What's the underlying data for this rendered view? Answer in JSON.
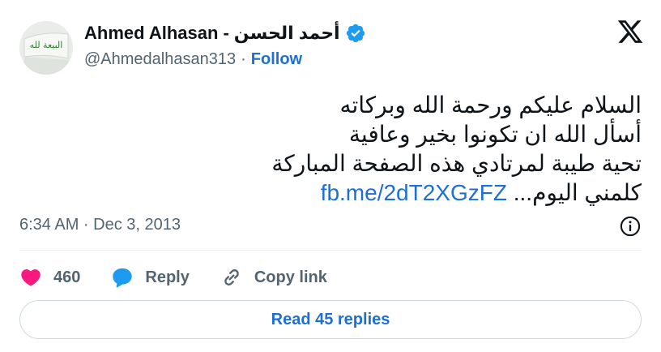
{
  "author": {
    "name": "Ahmed Alhasan",
    "name_separator": "-",
    "name_arabic": "أحمد الحسن",
    "handle": "@Ahmedalhasan313",
    "handle_separator": "·",
    "follow_label": "Follow",
    "avatar_text": "البيعة لله",
    "verified_icon": "verified-badge-icon"
  },
  "tweet": {
    "lines": [
      "السلام عليكم ورحمة الله وبركاته",
      "أسأل الله ان تكونوا بخير وعافية",
      "تحية طيبة لمرتادي هذه الصفحة المباركة"
    ],
    "last_line_text": "كلمني اليوم... ",
    "link": "fb.me/2dT2XGzFZ",
    "timestamp": "6:34 AM · Dec 3, 2013"
  },
  "actions": {
    "likes_count": "460",
    "reply_label": "Reply",
    "copy_link_label": "Copy link"
  },
  "read_replies_label": "Read 45 replies",
  "colors": {
    "accent": "#1d6fd6",
    "heart": "#f91880",
    "reply_bubble": "#1d9bf0",
    "muted": "#536471"
  }
}
